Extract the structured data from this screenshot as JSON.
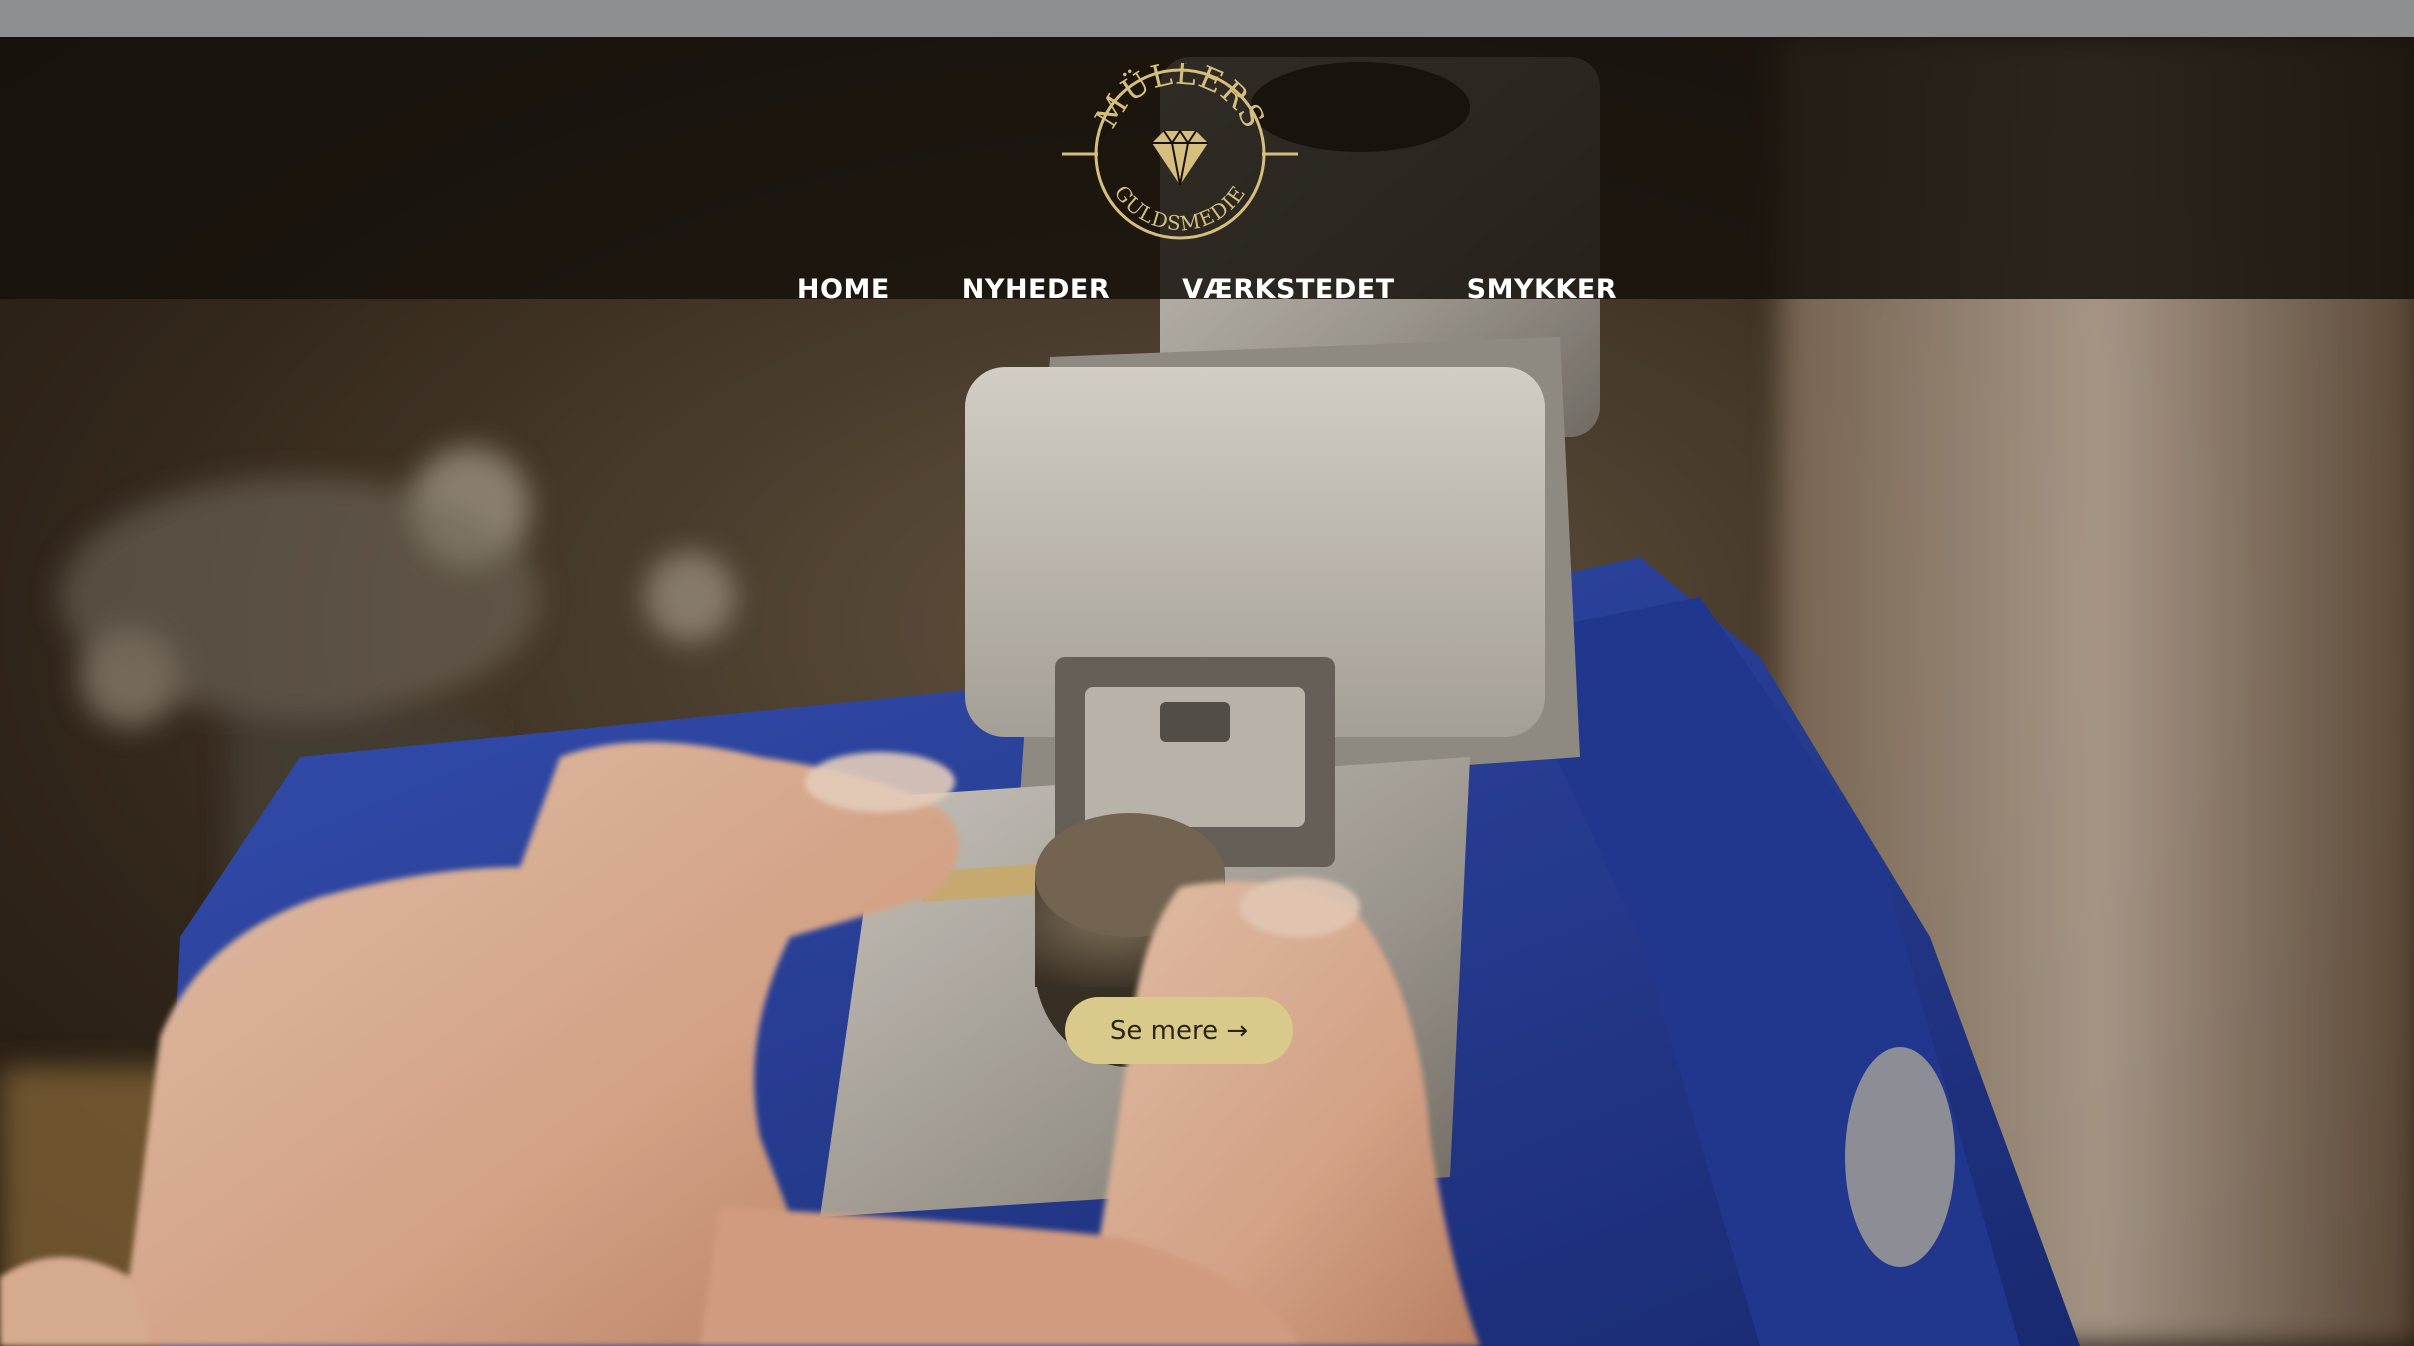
{
  "brand": {
    "name_top": "MÜLLERS",
    "name_bottom": "GULDSMEDIE",
    "logo_color": "#d6bf7e"
  },
  "nav": {
    "items": [
      {
        "label": "HOME"
      },
      {
        "label": "NYHEDER"
      },
      {
        "label": "VÆRKSTEDET"
      },
      {
        "label": "SMYKKER"
      }
    ]
  },
  "hero": {
    "cta_label": "Se mere →",
    "cta_color": "#d9c98a"
  },
  "colors": {
    "top_strip": "#8e8f92",
    "header_overlay": "#16110c",
    "vise_blue": "#2b45a6"
  }
}
